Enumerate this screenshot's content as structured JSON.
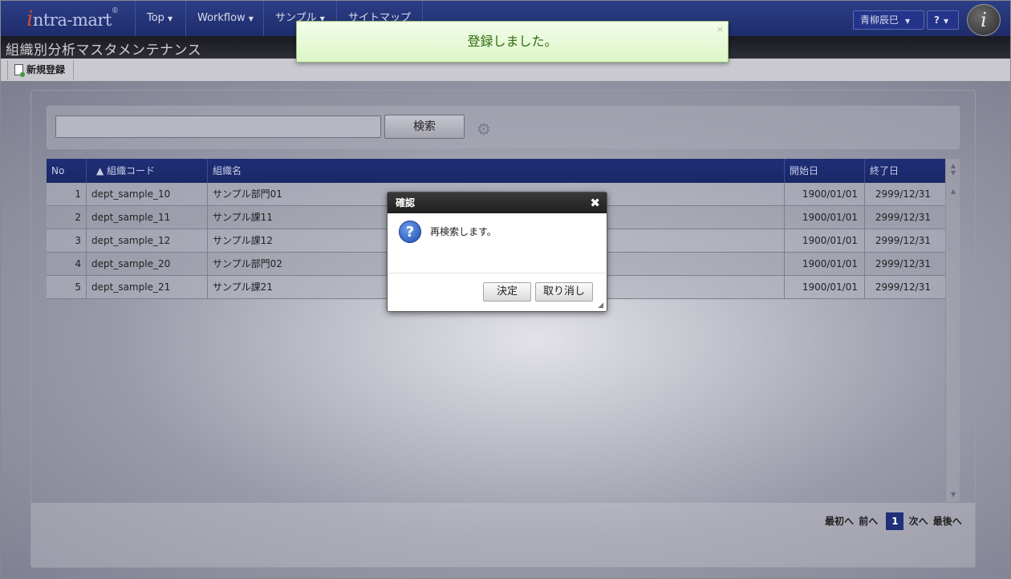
{
  "header": {
    "logo_text": "ntra-mart",
    "logo_i": "i",
    "nav": [
      {
        "label": "Top"
      },
      {
        "label": "Workflow"
      },
      {
        "label": "サンプル"
      },
      {
        "label": "サイトマップ"
      }
    ],
    "user_name": "青柳辰巳",
    "help_label": "?",
    "brand_mark": "i"
  },
  "page": {
    "title": "組織別分析マスタメンテナンス",
    "new_button": "新規登録"
  },
  "notification": {
    "message": "登録しました。",
    "close": "×"
  },
  "search": {
    "value": "",
    "button_label": "検索"
  },
  "grid": {
    "columns": [
      {
        "label": "No"
      },
      {
        "label": "▲ 組織コード"
      },
      {
        "label": "組織名"
      },
      {
        "label": "開始日"
      },
      {
        "label": "終了日"
      }
    ],
    "rows": [
      {
        "no": "1",
        "code": "dept_sample_10",
        "name": "サンプル部門01",
        "start": "1900/01/01",
        "end": "2999/12/31"
      },
      {
        "no": "2",
        "code": "dept_sample_11",
        "name": "サンプル課11",
        "start": "1900/01/01",
        "end": "2999/12/31"
      },
      {
        "no": "3",
        "code": "dept_sample_12",
        "name": "サンプル課12",
        "start": "1900/01/01",
        "end": "2999/12/31"
      },
      {
        "no": "4",
        "code": "dept_sample_20",
        "name": "サンプル部門02",
        "start": "1900/01/01",
        "end": "2999/12/31"
      },
      {
        "no": "5",
        "code": "dept_sample_21",
        "name": "サンプル課21",
        "start": "1900/01/01",
        "end": "2999/12/31"
      }
    ]
  },
  "pager": {
    "first": "最初へ",
    "prev": "前へ",
    "current": "1",
    "next": "次へ",
    "last": "最後へ"
  },
  "dialog": {
    "title": "確認",
    "close": "✖",
    "message": "再検索します。",
    "ok_label": "決定",
    "cancel_label": "取り消し"
  }
}
